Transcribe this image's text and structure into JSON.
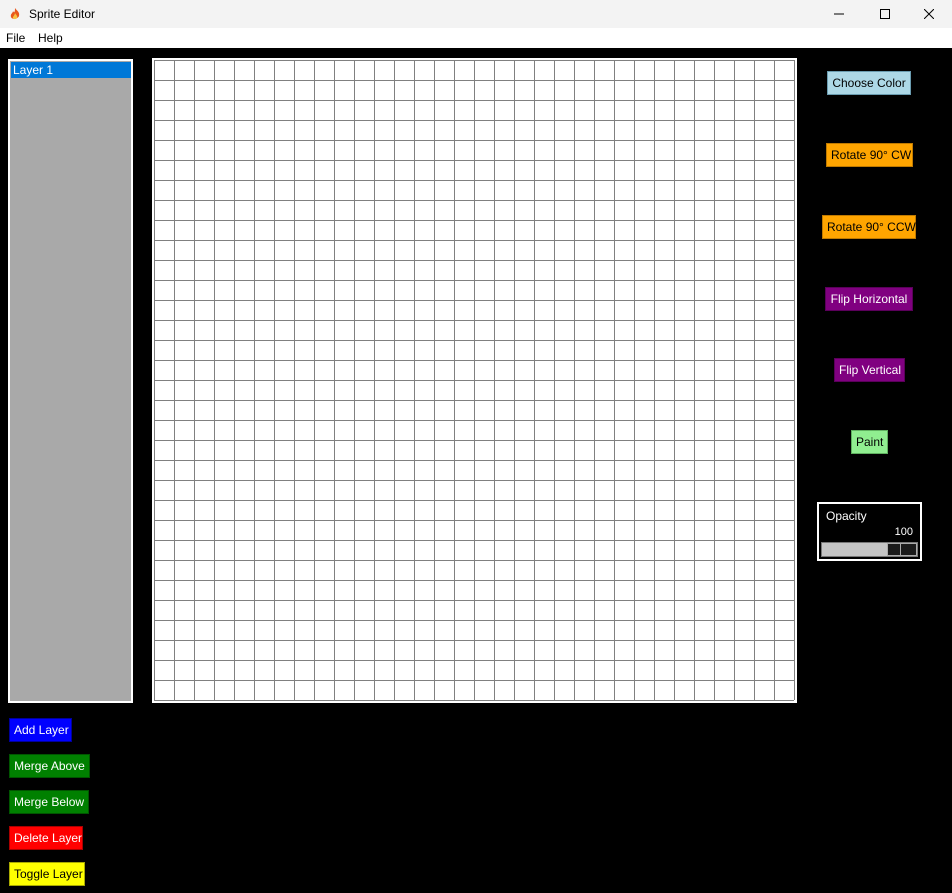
{
  "window": {
    "title": "Sprite Editor",
    "icon": "flame-icon"
  },
  "menu": {
    "items": [
      "File",
      "Help"
    ]
  },
  "layers": {
    "items": [
      {
        "label": "Layer 1",
        "selected": true
      }
    ],
    "panel_color": "#a9a9a9",
    "selected_color": "#0078d7"
  },
  "canvas": {
    "grid_columns": 32,
    "grid_rows": 32,
    "background": "#ffffff",
    "grid_line_color": "#808080"
  },
  "tools": {
    "choose_color": "Choose Color",
    "rotate_cw": "Rotate 90° CW",
    "rotate_ccw": "Rotate 90° CCW",
    "flip_horizontal": "Flip Horizontal",
    "flip_vertical": "Flip Vertical",
    "paint": "Paint"
  },
  "opacity": {
    "label": "Opacity",
    "value": "100",
    "fraction": 1.0
  },
  "layer_actions": {
    "add": "Add Layer",
    "merge_above": "Merge Above",
    "merge_below": "Merge Below",
    "delete": "Delete Layer",
    "toggle": "Toggle Layer"
  },
  "colors": {
    "light_blue": "#add8e6",
    "orange": "#ffa500",
    "purple": "#800080",
    "light_green": "#90ee90",
    "blue": "#0000ff",
    "green": "#008000",
    "red": "#ff0000",
    "yellow": "#ffff00"
  }
}
